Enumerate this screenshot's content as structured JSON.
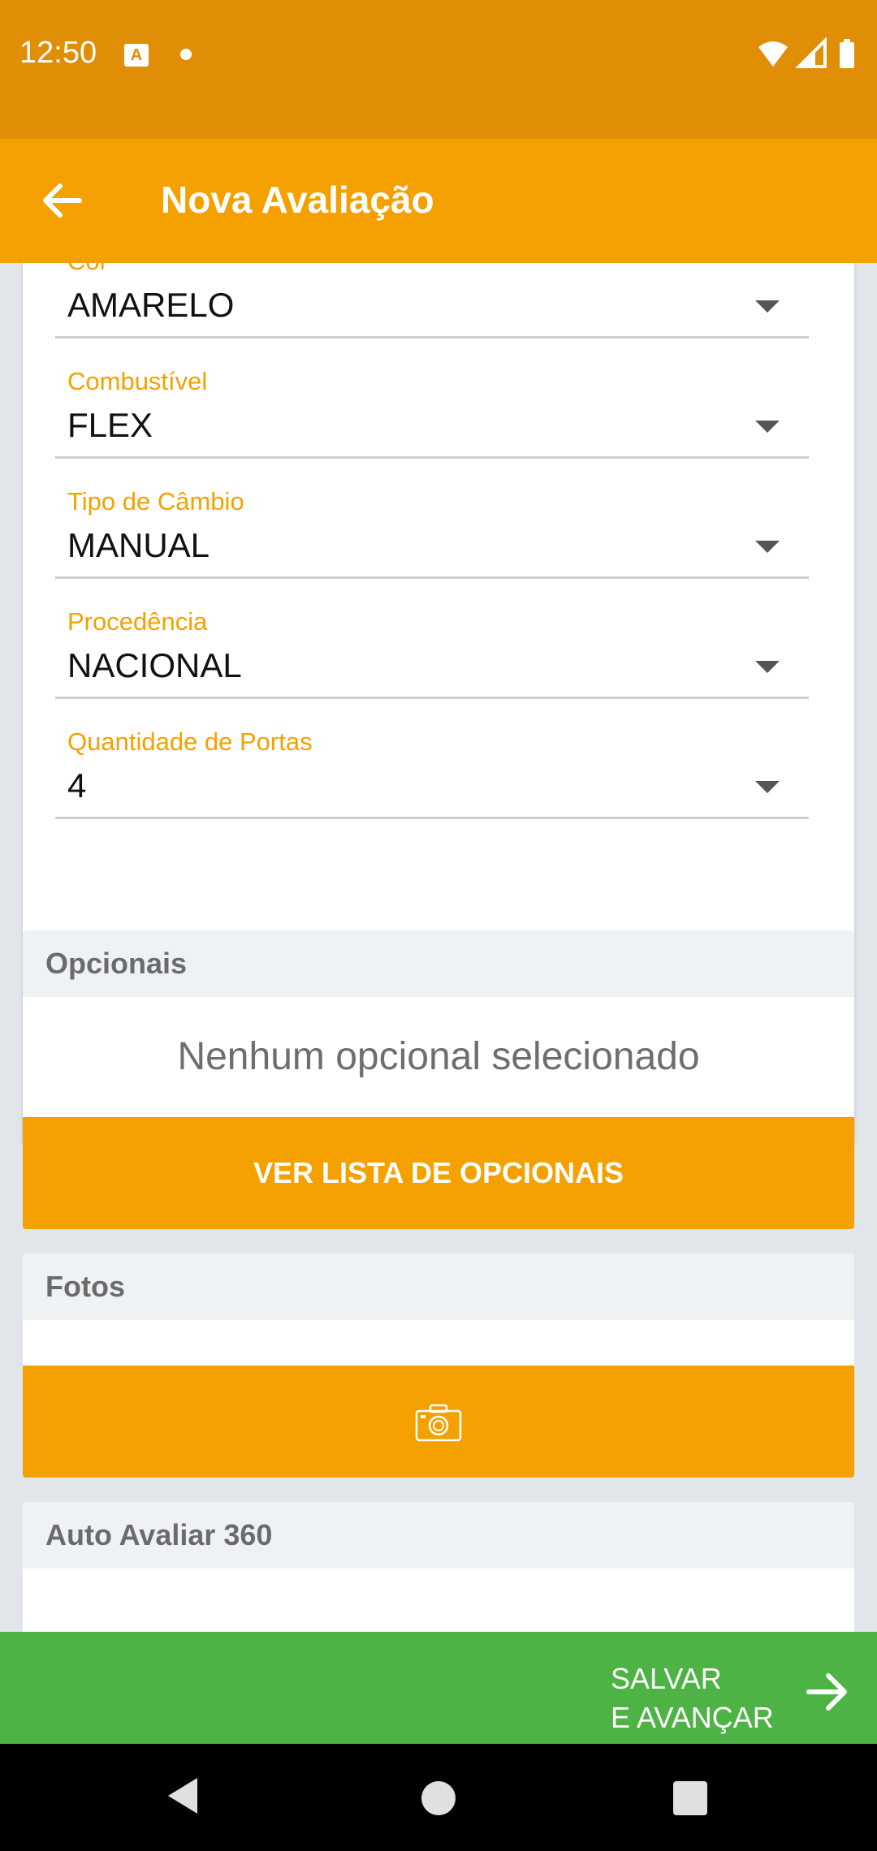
{
  "status_bar": {
    "time": "12:50",
    "notification_letter": "A"
  },
  "app_bar": {
    "title": "Nova Avaliação"
  },
  "fields": [
    {
      "label": "Cor",
      "value": "AMARELO"
    },
    {
      "label": "Combustível",
      "value": "FLEX"
    },
    {
      "label": "Tipo de Câmbio",
      "value": "MANUAL"
    },
    {
      "label": "Procedência",
      "value": "NACIONAL"
    },
    {
      "label": "Quantidade de Portas",
      "value": "4"
    }
  ],
  "opcionais": {
    "header": "Opcionais",
    "empty_text": "Nenhum opcional selecionado",
    "button_label": "VER LISTA DE OPCIONAIS"
  },
  "fotos": {
    "header": "Fotos"
  },
  "auto360": {
    "header": "Auto Avaliar 360"
  },
  "save": {
    "line1": "SALVAR",
    "line2": "E AVANÇAR"
  },
  "colors": {
    "primary": "#f4a100",
    "status_bar": "#e08e06",
    "save_green": "#4cb344"
  }
}
